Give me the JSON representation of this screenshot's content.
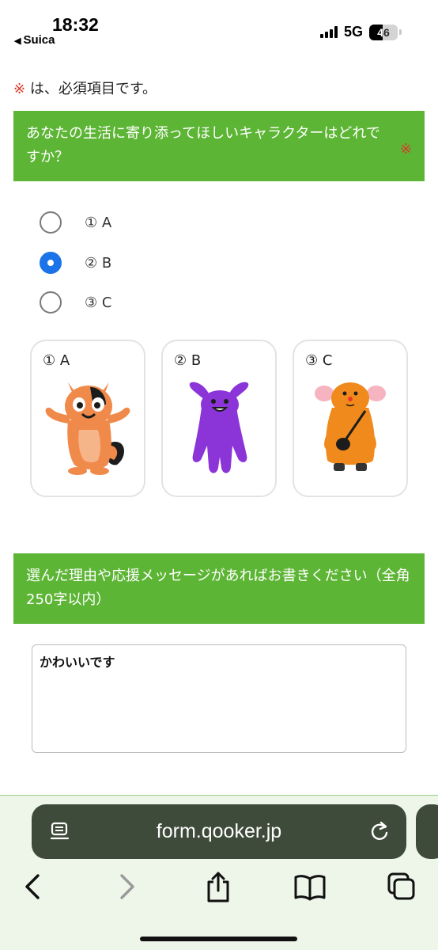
{
  "status_bar": {
    "time": "18:32",
    "back_app": "Suica",
    "network": "5G",
    "battery": "46",
    "battery_level": 0.46
  },
  "form": {
    "required_mark": "※",
    "required_note": "は、必須項目です。",
    "question1": {
      "title": "あなたの生活に寄り添ってほしいキャラクターはどれですか？",
      "required_mark": "※",
      "options": [
        "① A",
        "② B",
        "③ C"
      ],
      "selected": "② B"
    },
    "characters": [
      {
        "label": "① A",
        "icon": "orange-fox-character-icon"
      },
      {
        "label": "② B",
        "icon": "purple-rabbit-character-icon"
      },
      {
        "label": "③ C",
        "icon": "orange-monkey-character-icon"
      }
    ],
    "question2": {
      "title": "選んだ理由や応援メッセージがあればお書きください（全角250字以内）",
      "value": "かわいいです"
    }
  },
  "browser": {
    "url": "form.qooker.jp",
    "accent": "#5db535"
  }
}
